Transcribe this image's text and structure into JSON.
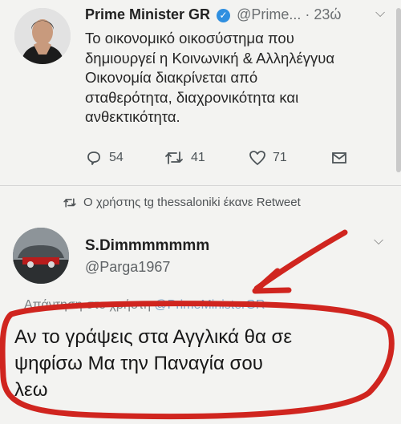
{
  "tweet": {
    "name": "Prime Minister GR",
    "handle": "@Prime...",
    "time": "· 23ώ",
    "text_lines": [
      "Το οικονομικό οικοσύστημα που",
      "δημιουργεί η Κοινωνική & Αλληλέγγυα",
      "Οικονομία διακρίνεται από",
      "σταθερότητα, διαχρονικότητα και",
      "ανθεκτικότητα."
    ],
    "replies": "54",
    "retweets": "41",
    "likes": "71"
  },
  "retweet_notice": "Ο χρήστης tg thessaloniki έκανε Retweet",
  "reply": {
    "name": "S.Dimmmmmmm",
    "handle": "@Parga1967",
    "replying_prefix": "Απάντηση στο χρήστη ",
    "replying_mention": "@PrimeMinisterGR",
    "text_lines": [
      "Αν το γράψεις στα Αγγλικά θα σε",
      "ψηφίσω  Μα την Παναγία σου",
      "λεω"
    ]
  },
  "colors": {
    "verified": "#2f8fe0",
    "annotation": "#d0251f",
    "icons": "#4d5458"
  },
  "icons": [
    "verified-icon",
    "reply-icon",
    "retweet-icon",
    "like-icon",
    "message-icon",
    "chevron-down-icon"
  ]
}
